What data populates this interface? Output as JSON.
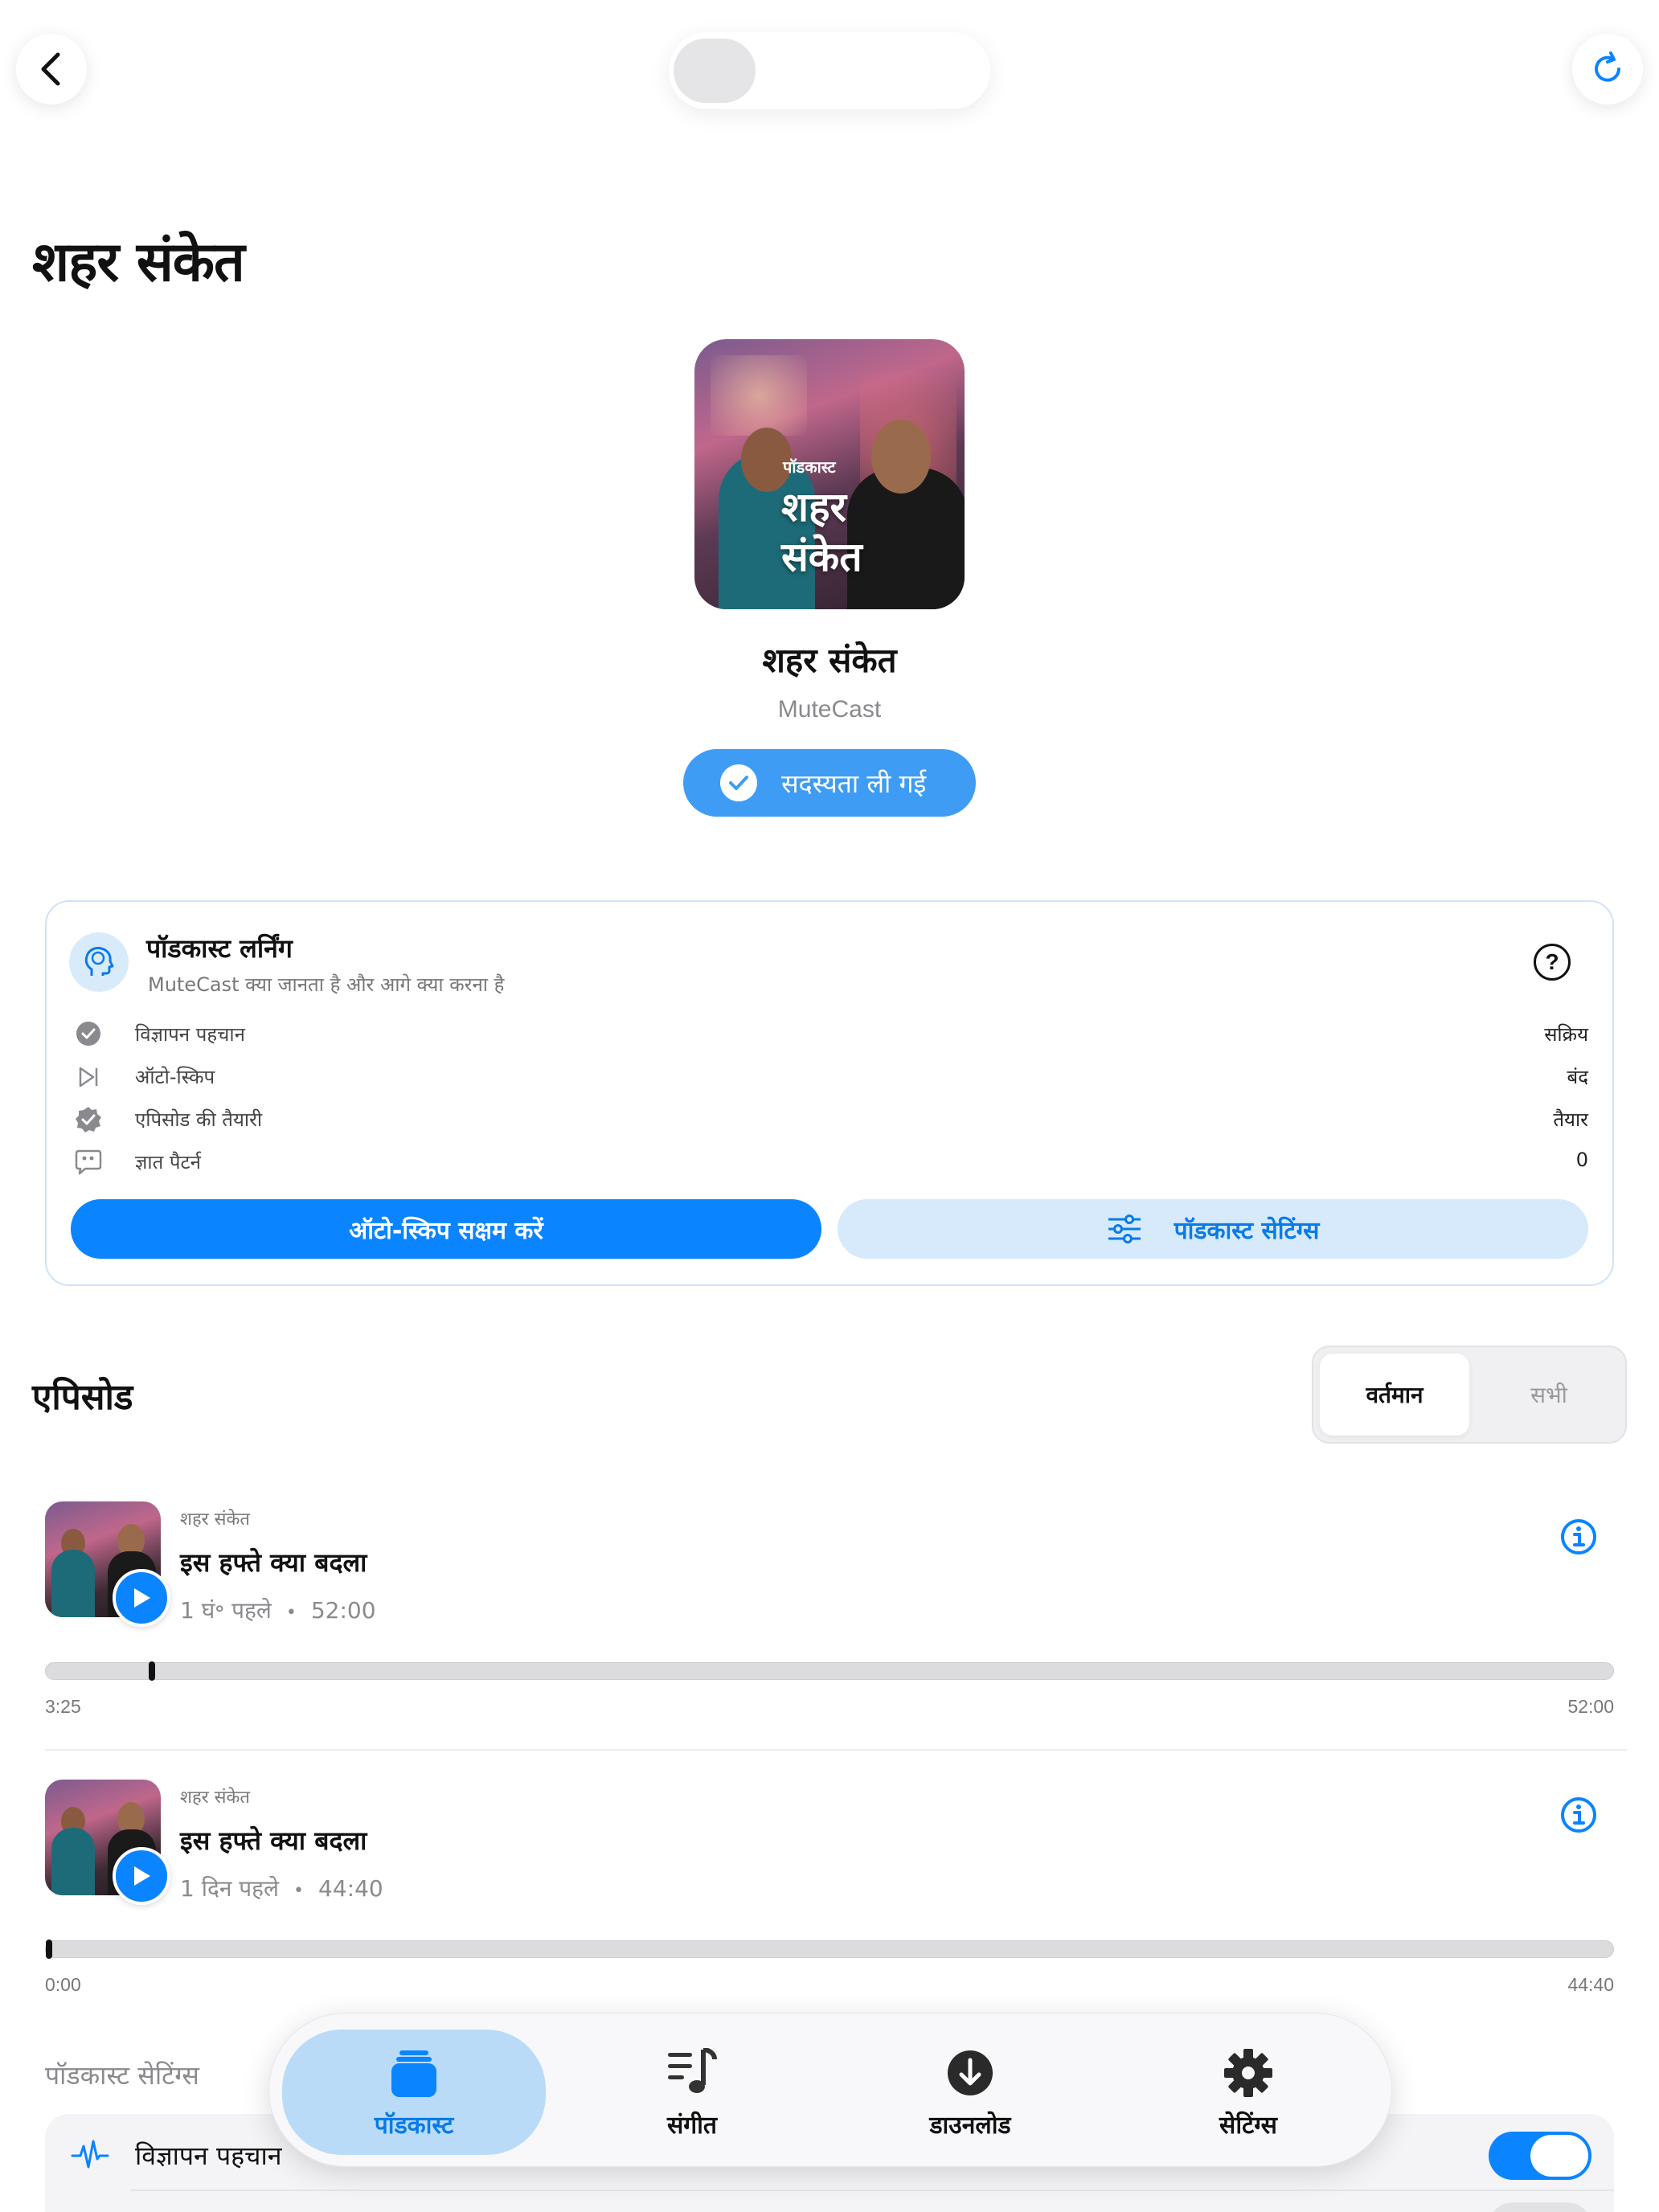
{
  "header": {
    "page_title": "शहर संकेत"
  },
  "podcast": {
    "cover_tag": "पॉडकास्ट",
    "cover_title_line1": "शहर",
    "cover_title_line2": "संकेत",
    "name": "शहर संकेत",
    "author": "MuteCast",
    "subscribed_label": "सदस्यता ली गई"
  },
  "learning": {
    "title": "पॉडकास्ट लर्निंग",
    "subtitle": "MuteCast क्या जानता है और आगे क्या करना है",
    "rows": [
      {
        "label": "विज्ञापन पहचान",
        "value": "सक्रिय",
        "icon": "check-circle-icon"
      },
      {
        "label": "ऑटो-स्किप",
        "value": "बंद",
        "icon": "skip-forward-icon"
      },
      {
        "label": "एपिसोड की तैयारी",
        "value": "तैयार",
        "icon": "verified-badge-icon"
      },
      {
        "label": "ज्ञात पैटर्न",
        "value": "0",
        "icon": "quote-bubble-icon"
      }
    ],
    "primary_button": "ऑटो-स्किप सक्षम करें",
    "secondary_button": "पॉडकास्ट सेटिंग्स"
  },
  "episodes": {
    "heading": "एपिसोड",
    "segments": [
      "वर्तमान",
      "सभी"
    ],
    "selected_segment": "वर्तमान",
    "items": [
      {
        "podcast": "शहर संकेत",
        "title": "इस हफ्ते क्या बदला",
        "age": "1 घं॰ पहले",
        "duration": "52:00",
        "elapsed": "3:25",
        "total": "52:00",
        "progress": 0.066
      },
      {
        "podcast": "शहर संकेत",
        "title": "इस हफ्ते क्या बदला",
        "age": "1 दिन पहले",
        "duration": "44:40",
        "elapsed": "0:00",
        "total": "44:40",
        "progress": 0.0
      }
    ],
    "meta_separator": "•"
  },
  "podcast_settings": {
    "section_label": "पॉडकास्ट सेटिंग्स",
    "ad_detection_label": "विज्ञापन पहचान",
    "ad_detection_on": true
  },
  "tabbar": {
    "tabs": [
      {
        "label": "पॉडकास्ट",
        "icon": "podcast-stack-icon",
        "active": true
      },
      {
        "label": "संगीत",
        "icon": "music-list-icon",
        "active": false
      },
      {
        "label": "डाउनलोड",
        "icon": "download-icon",
        "active": false
      },
      {
        "label": "सेटिंग्स",
        "icon": "gear-icon",
        "active": false
      }
    ]
  },
  "colors": {
    "accent": "#0a84ff",
    "accent_light": "#d6eafb",
    "subscribed": "#3e9cf4"
  }
}
